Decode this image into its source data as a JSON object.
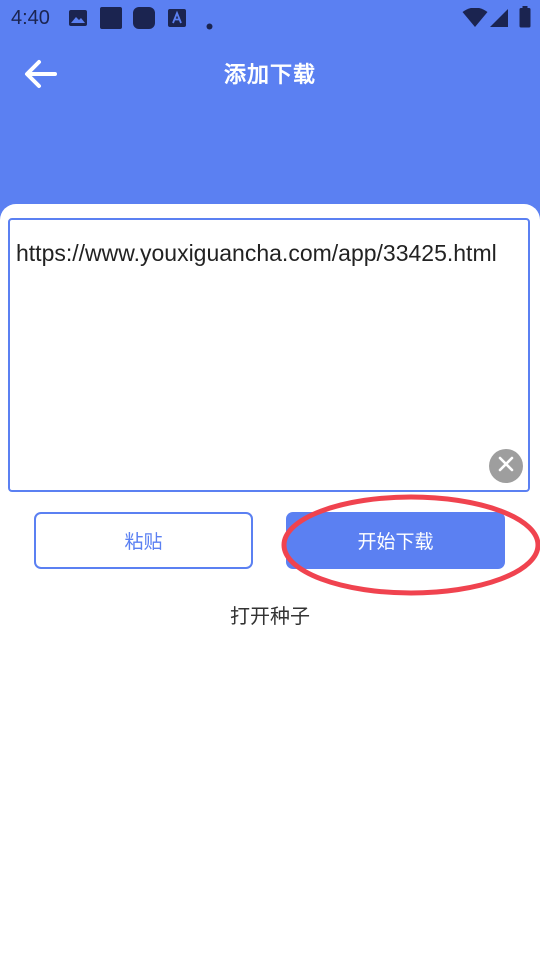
{
  "status_bar": {
    "time": "4:40",
    "left_icons": [
      "image-icon",
      "app-square-icon",
      "app-rounded-icon",
      "font-a-icon",
      "dot-icon"
    ],
    "right_icons": [
      "wifi-icon",
      "cellular-signal-icon",
      "battery-icon"
    ]
  },
  "app_bar": {
    "title": "添加下载",
    "back_icon": "arrow-back-icon"
  },
  "url_input": {
    "value": "https://www.youxiguancha.com/app/33425.html",
    "clear_icon": "close-circle-icon"
  },
  "buttons": {
    "paste": "粘贴",
    "start_download": "开始下载"
  },
  "open_torrent": "打开种子",
  "colors": {
    "primary": "#5b80f2",
    "annotation_circle": "#f0434f",
    "status_icons": "#1b2450"
  }
}
